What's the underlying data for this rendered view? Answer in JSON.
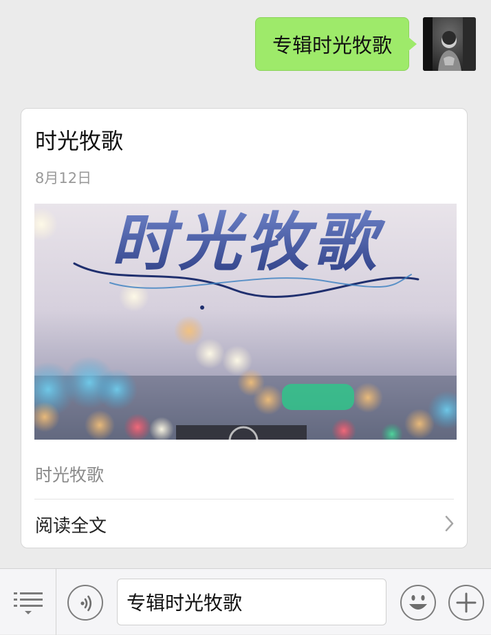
{
  "chat": {
    "outgoing_message": "专辑时光牧歌"
  },
  "article_card": {
    "title": "时光牧歌",
    "date": "8月12日",
    "cover_title": "时光牧歌",
    "description": "时光牧歌",
    "read_more_label": "阅读全文"
  },
  "toolbar": {
    "input_value": "专辑时光牧歌",
    "icons": [
      "menu-icon",
      "voice-icon",
      "emoji-icon",
      "plus-icon"
    ]
  },
  "colors": {
    "chat_background": "#ebebeb",
    "outgoing_bubble": "#9eea6a",
    "card_background": "#ffffff",
    "muted_text": "#999999"
  }
}
